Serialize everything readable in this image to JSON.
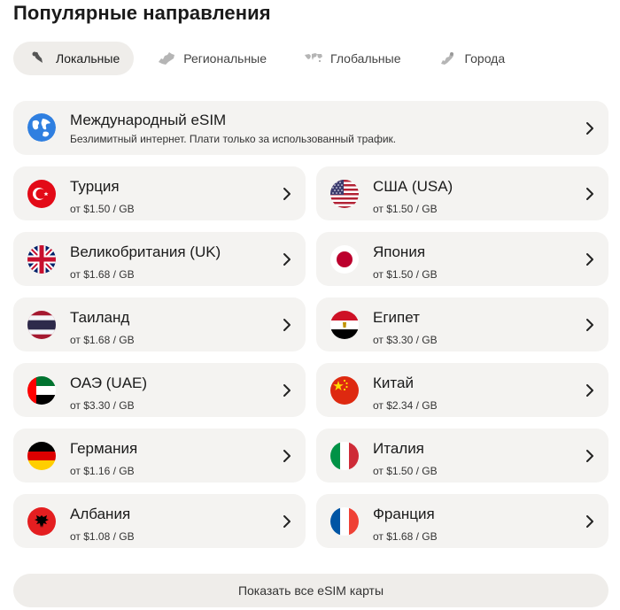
{
  "page_title": "Популярные направления",
  "tabs": [
    {
      "label": "Локальные",
      "icon": "local-pin-icon",
      "active": true
    },
    {
      "label": "Региональные",
      "icon": "region-map-icon",
      "active": false
    },
    {
      "label": "Глобальные",
      "icon": "world-map-icon",
      "active": false
    },
    {
      "label": "Города",
      "icon": "city-map-icon",
      "active": false
    }
  ],
  "international": {
    "name": "Международный eSIM",
    "description": "Безлимитный интернет. Плати только за использованный трафик.",
    "icon": "globe-icon"
  },
  "destinations": [
    {
      "name": "Турция",
      "price": "от $1.50 / GB",
      "flag": "turkey"
    },
    {
      "name": "США (USA)",
      "price": "от $1.50 / GB",
      "flag": "usa"
    },
    {
      "name": "Великобритания (UK)",
      "price": "от $1.68 / GB",
      "flag": "uk"
    },
    {
      "name": "Япония",
      "price": "от $1.50 / GB",
      "flag": "japan"
    },
    {
      "name": "Таиланд",
      "price": "от $1.68 / GB",
      "flag": "thailand"
    },
    {
      "name": "Египет",
      "price": "от $3.30 / GB",
      "flag": "egypt"
    },
    {
      "name": "ОАЭ (UAE)",
      "price": "от $3.30 / GB",
      "flag": "uae"
    },
    {
      "name": "Китай",
      "price": "от $2.34 / GB",
      "flag": "china"
    },
    {
      "name": "Германия",
      "price": "от $1.16 / GB",
      "flag": "germany"
    },
    {
      "name": "Италия",
      "price": "от $1.50 / GB",
      "flag": "italy"
    },
    {
      "name": "Албания",
      "price": "от $1.08 / GB",
      "flag": "albania"
    },
    {
      "name": "Франция",
      "price": "от $1.68 / GB",
      "flag": "france"
    }
  ],
  "show_all_label": "Показать все eSIM карты",
  "colors": {
    "card_bg": "#f4f3f1",
    "tab_active_bg": "#efedea",
    "text": "#1a1a1a"
  }
}
